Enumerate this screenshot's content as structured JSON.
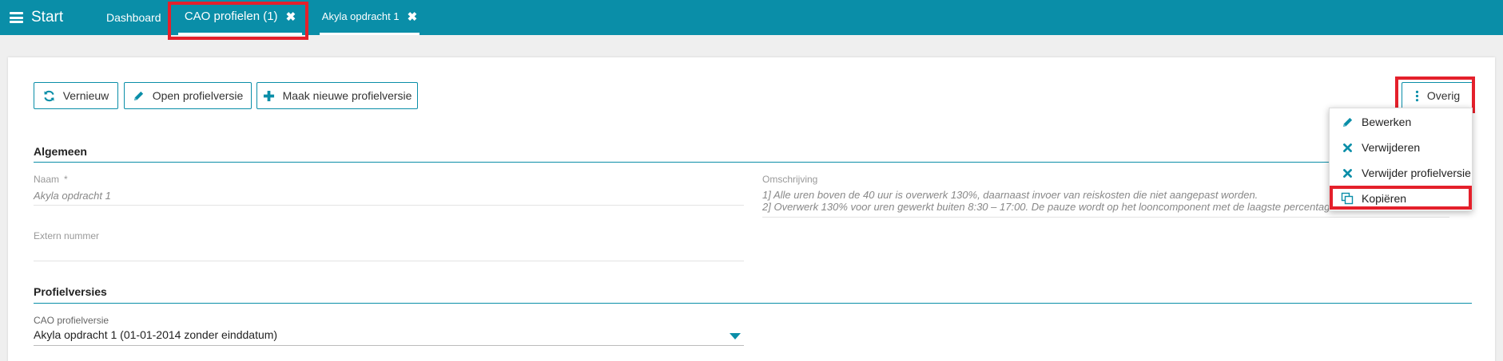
{
  "topbar": {
    "menu_label": "Start",
    "tabs": [
      {
        "label": "Dashboard"
      },
      {
        "label": "CAO profielen (1)"
      },
      {
        "label": "Akyla opdracht 1"
      }
    ]
  },
  "toolbar": {
    "refresh_label": "Vernieuw",
    "open_label": "Open profielversie",
    "new_label": "Maak nieuwe profielversie",
    "more_label": "Overig"
  },
  "general": {
    "title": "Algemeen",
    "name_label": "Naam",
    "name_required": "*",
    "name_value": "Akyla opdracht 1",
    "external_label": "Extern nummer",
    "external_value": "",
    "description_label": "Omschrijving",
    "description_line1": "1]   Alle uren boven de 40 uur is overwerk 130%, daarnaast invoer van reiskosten die niet aangepast worden.",
    "description_line2": "2]   Overwerk 130% voor uren gewerkt buiten 8:30 – 17:00. De pauze wordt op het looncomponent met de laagste percentage"
  },
  "profile_versions": {
    "title": "Profielversies",
    "select_label": "CAO profielversie",
    "select_value": "Akyla opdracht 1 (01-01-2014 zonder einddatum)"
  },
  "dropdown": {
    "items": [
      {
        "label": "Bewerken",
        "icon": "pencil-icon"
      },
      {
        "label": "Verwijderen",
        "icon": "close-icon"
      },
      {
        "label": "Verwijder profielversie",
        "icon": "close-icon"
      },
      {
        "label": "Kopiëren",
        "icon": "copy-icon"
      }
    ]
  },
  "colors": {
    "accent": "#0a8ea8",
    "highlight": "#e4202b"
  }
}
